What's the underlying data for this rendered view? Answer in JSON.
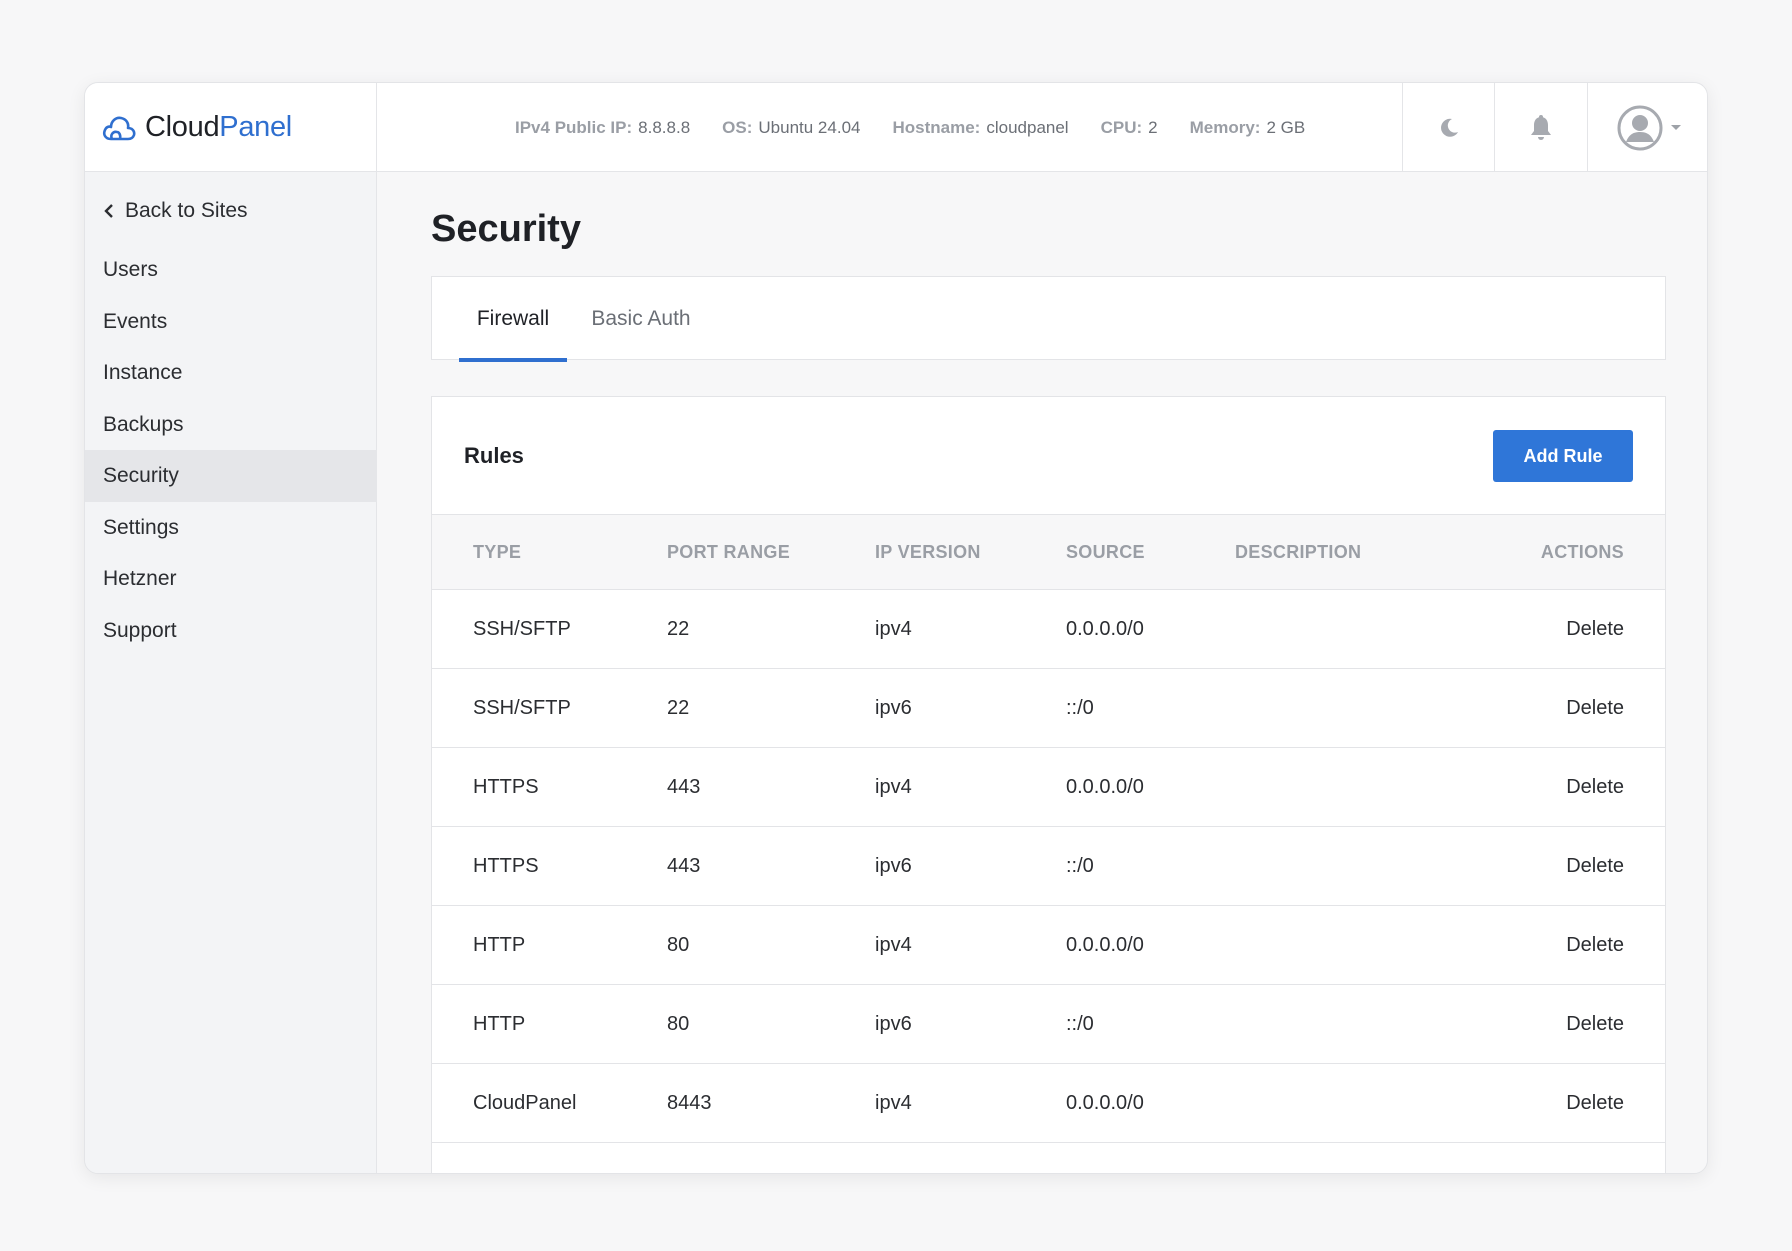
{
  "header": {
    "logo": {
      "part1": "Cloud",
      "part2": "Panel"
    },
    "sysinfo": [
      {
        "key": "IPv4 Public IP:",
        "value": "8.8.8.8"
      },
      {
        "key": "OS:",
        "value": "Ubuntu 24.04"
      },
      {
        "key": "Hostname:",
        "value": "cloudpanel"
      },
      {
        "key": "CPU:",
        "value": "2"
      },
      {
        "key": "Memory:",
        "value": "2 GB"
      }
    ],
    "icons": {
      "theme": "moon-icon",
      "notifications": "bell-icon",
      "user": "avatar-icon"
    }
  },
  "sidebar": {
    "back_label": "Back to Sites",
    "items": [
      {
        "label": "Users"
      },
      {
        "label": "Events"
      },
      {
        "label": "Instance"
      },
      {
        "label": "Backups"
      },
      {
        "label": "Security",
        "active": true
      },
      {
        "label": "Settings"
      },
      {
        "label": "Hetzner"
      },
      {
        "label": "Support"
      }
    ]
  },
  "main": {
    "title": "Security",
    "tabs": [
      {
        "label": "Firewall",
        "active": true
      },
      {
        "label": "Basic Auth"
      }
    ],
    "rules": {
      "title": "Rules",
      "add_label": "Add Rule",
      "columns": [
        "TYPE",
        "PORT RANGE",
        "IP VERSION",
        "SOURCE",
        "DESCRIPTION",
        "ACTIONS"
      ],
      "rows": [
        {
          "type": "SSH/SFTP",
          "port": "22",
          "ip": "ipv4",
          "source": "0.0.0.0/0",
          "description": "",
          "action": "Delete"
        },
        {
          "type": "SSH/SFTP",
          "port": "22",
          "ip": "ipv6",
          "source": "::/0",
          "description": "",
          "action": "Delete"
        },
        {
          "type": "HTTPS",
          "port": "443",
          "ip": "ipv4",
          "source": "0.0.0.0/0",
          "description": "",
          "action": "Delete"
        },
        {
          "type": "HTTPS",
          "port": "443",
          "ip": "ipv6",
          "source": "::/0",
          "description": "",
          "action": "Delete"
        },
        {
          "type": "HTTP",
          "port": "80",
          "ip": "ipv4",
          "source": "0.0.0.0/0",
          "description": "",
          "action": "Delete"
        },
        {
          "type": "HTTP",
          "port": "80",
          "ip": "ipv6",
          "source": "::/0",
          "description": "",
          "action": "Delete"
        },
        {
          "type": "CloudPanel",
          "port": "8443",
          "ip": "ipv4",
          "source": "0.0.0.0/0",
          "description": "",
          "action": "Delete"
        }
      ]
    }
  },
  "colors": {
    "accent": "#2f76d8",
    "brand": "#2f6fcf",
    "active_nav": "#e5e6e9"
  }
}
